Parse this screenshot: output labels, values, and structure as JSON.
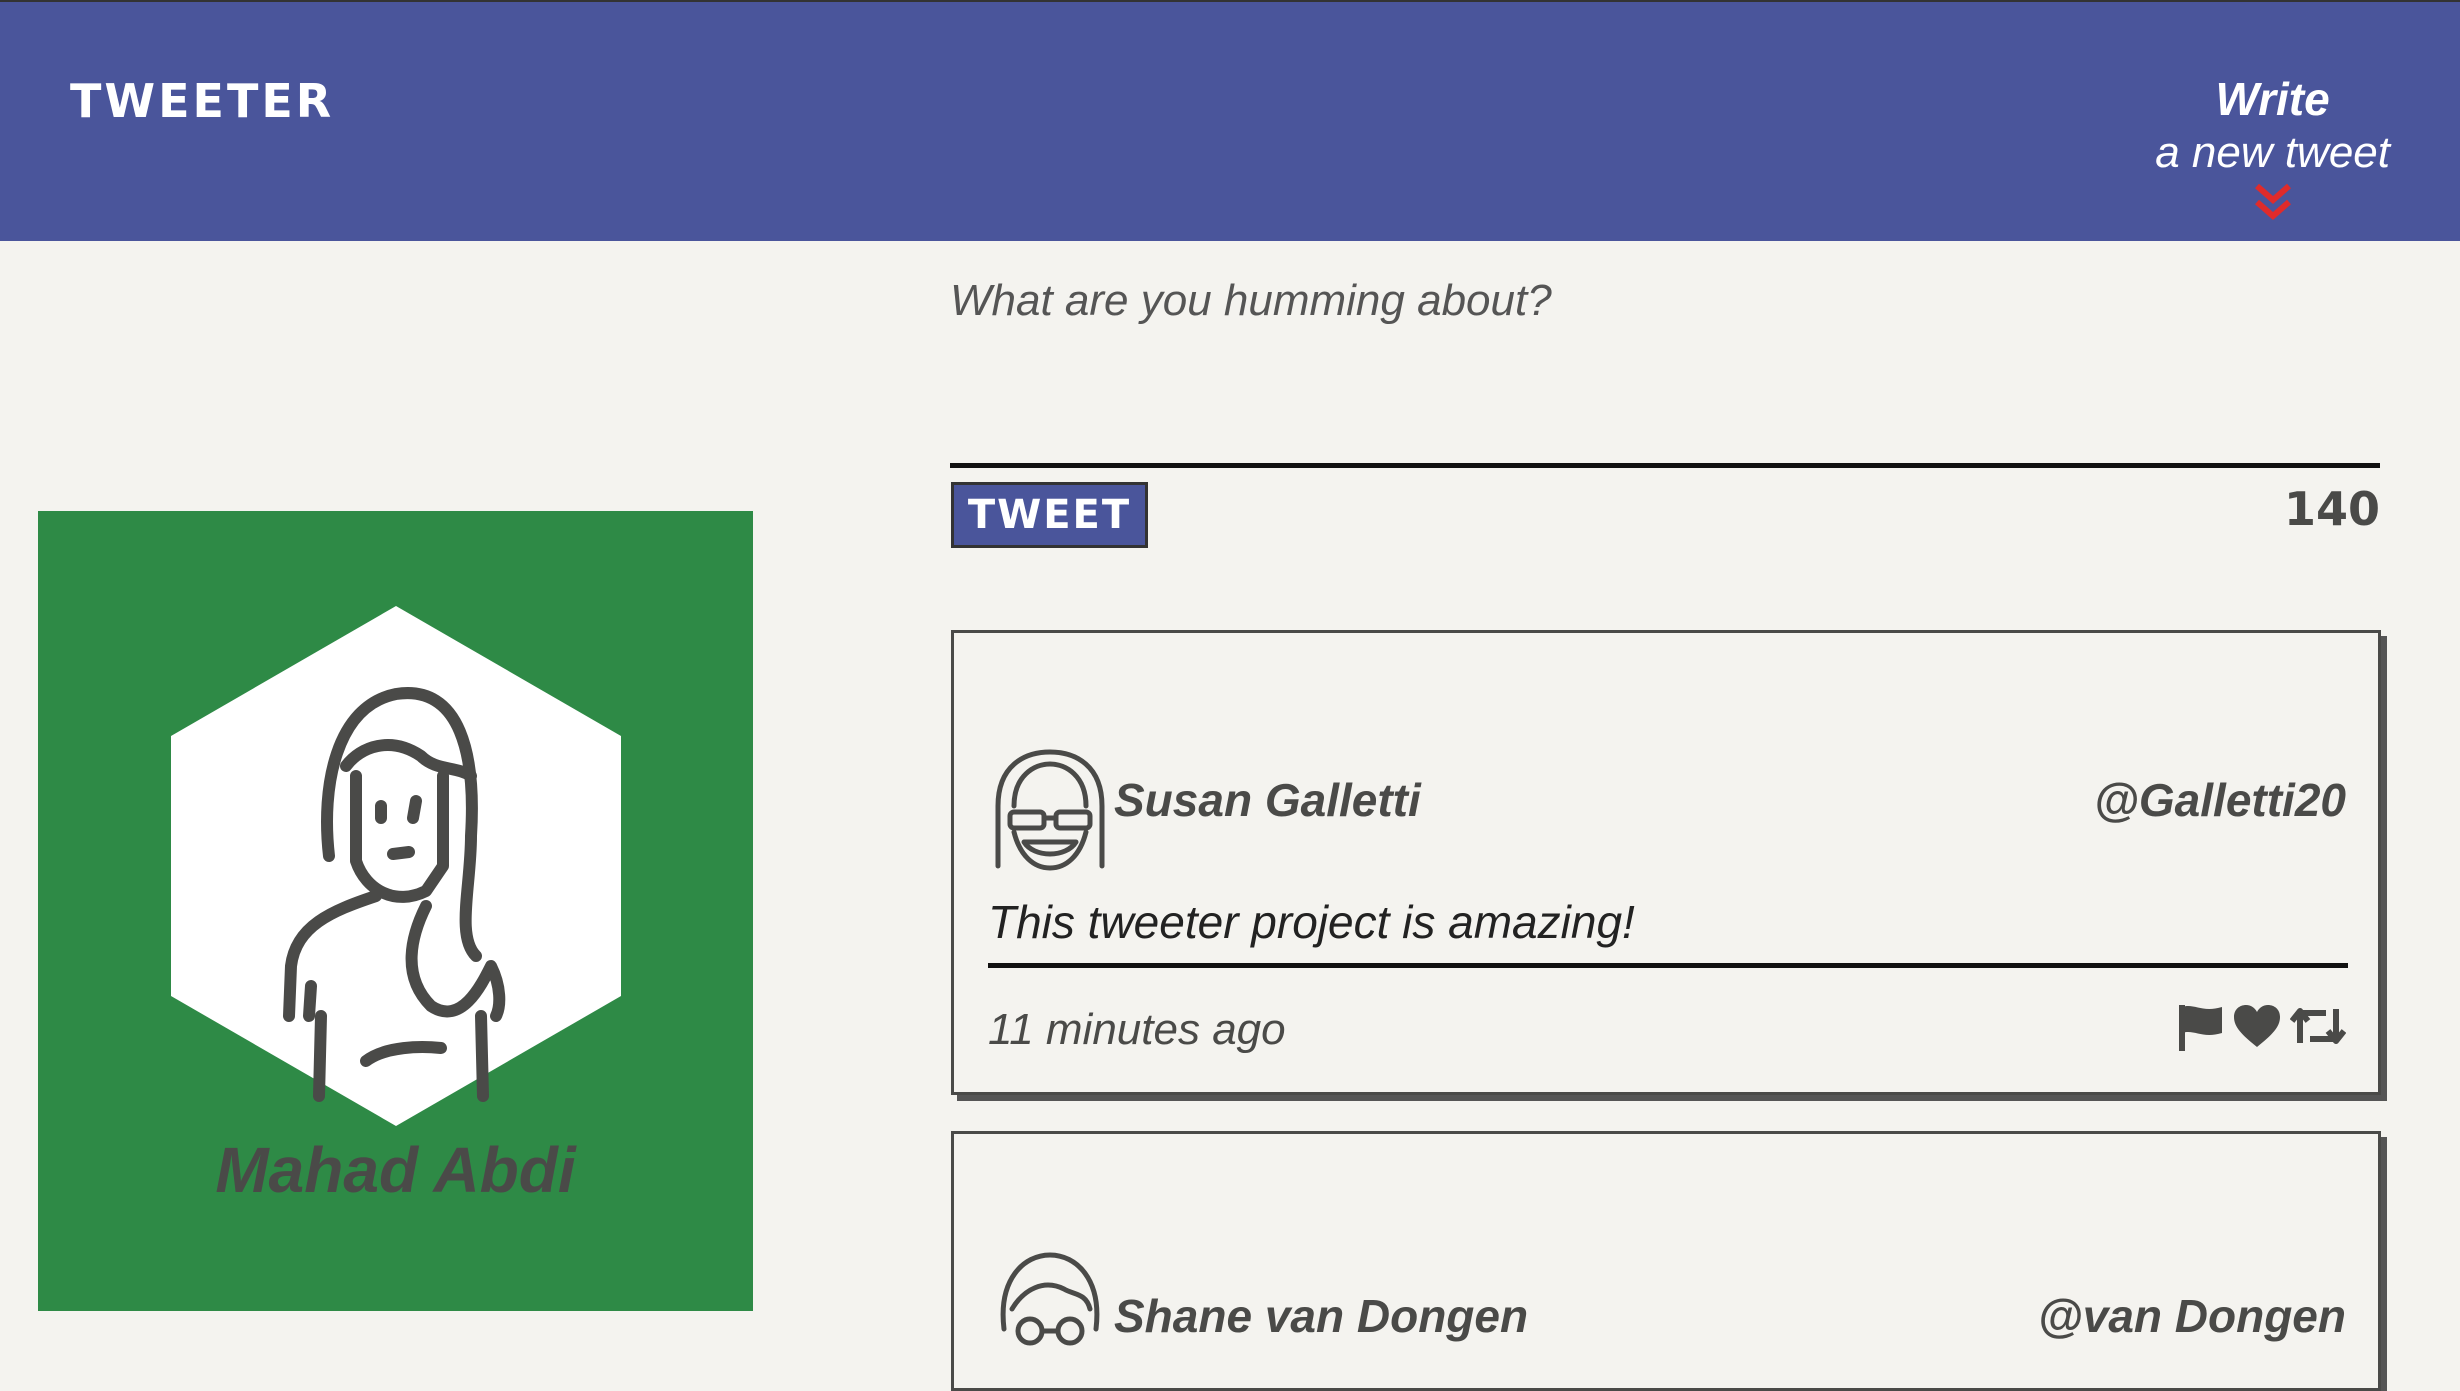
{
  "nav": {
    "brand": "TWEETER",
    "compose_line1": "Write",
    "compose_line2": "a new tweet"
  },
  "profile": {
    "name": "Mahad Abdi",
    "background_color": "#2e8a46"
  },
  "composer": {
    "placeholder": "What are you humming about?",
    "submit_label": "TWEET",
    "char_count": "140"
  },
  "tweets": [
    {
      "name": "Susan Galletti",
      "handle": "@Galletti20",
      "text": "This tweeter project is amazing!",
      "time": "11 minutes ago",
      "icons": [
        "flag-icon",
        "heart-icon",
        "retweet-icon"
      ]
    },
    {
      "name": "Shane van Dongen",
      "handle": "@van Dongen"
    }
  ],
  "colors": {
    "nav": "#4a559b",
    "accent": "#e02b2b",
    "page": "#f4f3ef"
  }
}
